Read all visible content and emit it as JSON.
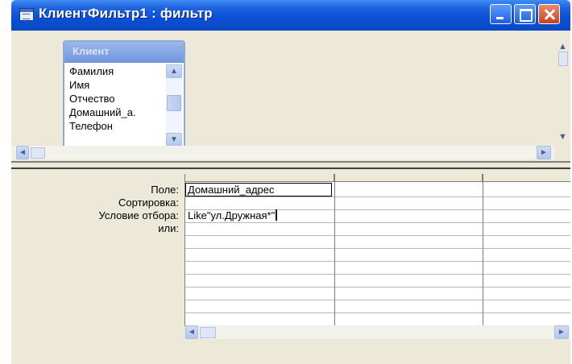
{
  "window": {
    "title": "КлиентФильтр1 : фильтр"
  },
  "table_box": {
    "title": "Клиент",
    "fields": [
      "Фамилия",
      "Имя",
      "Отчество",
      "Домашний_а.",
      "Телефон"
    ]
  },
  "grid": {
    "row_labels": [
      "Поле:",
      "Сортировка:",
      "Условие отбора:",
      "или:"
    ],
    "columns": [
      {
        "field": "Домашний_адрес",
        "sort": "",
        "criteria": "Like\"ул.Дружная*\"",
        "or": ""
      },
      {
        "field": "",
        "sort": "",
        "criteria": "",
        "or": ""
      },
      {
        "field": "",
        "sort": "",
        "criteria": "",
        "or": ""
      }
    ]
  },
  "colors": {
    "titlebar": "#0a4fd6",
    "window_bg": "#ece9d8",
    "table_header": "#7ea0e0"
  }
}
